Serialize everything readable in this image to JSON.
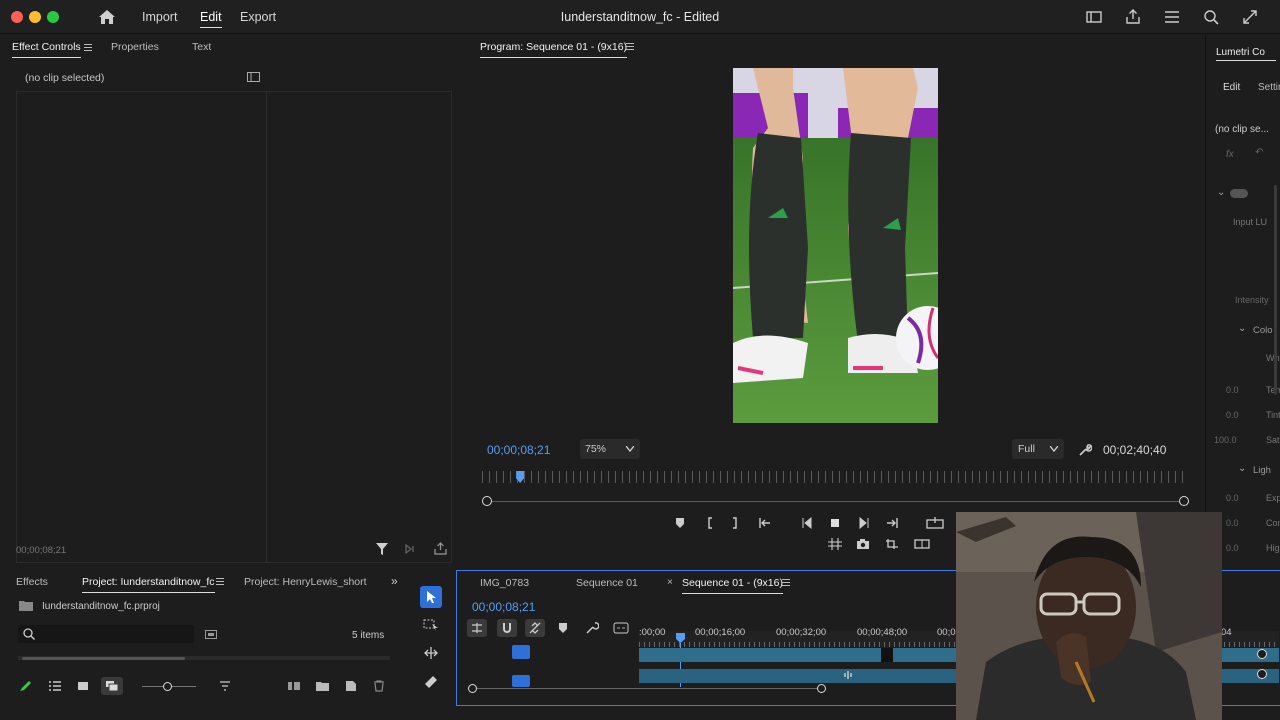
{
  "topbar": {
    "nav": [
      "Import",
      "Edit",
      "Export"
    ],
    "active_nav": "Edit",
    "title": "Iunderstanditnow_fc - Edited"
  },
  "effect_controls": {
    "tabs": [
      "Effect Controls",
      "Properties",
      "Text"
    ],
    "no_clip": "(no clip selected)",
    "timecode": "00;00;08;21"
  },
  "program": {
    "title": "Program: Sequence 01 - (9x16)",
    "timecode": "00;00;08;21",
    "zoom": "75%",
    "quality": "Full",
    "duration": "00;02;40;40",
    "playhead_fraction": 0.054
  },
  "lumetri": {
    "title": "Lumetri Co",
    "tabs": [
      "Edit",
      "Settin"
    ],
    "no_clip": "(no clip se...",
    "rows": [
      "Input LU",
      "Intensity",
      "Colo",
      "Whi",
      "Tem",
      "Tint",
      "Satu",
      "Ligh",
      "Exp",
      "Con",
      "High"
    ],
    "values": [
      "0.0",
      "0.0",
      "100.0",
      "0.0",
      "0.0",
      "0.0"
    ]
  },
  "project": {
    "tabs": [
      "Effects",
      "Project: Iunderstanditnow_fc",
      "Project: HenryLewis_short"
    ],
    "file": "Iunderstanditnow_fc.prproj",
    "items_count": "5 items",
    "search_placeholder": ""
  },
  "timeline": {
    "tabs": [
      "IMG_0783",
      "Sequence 01",
      "Sequence 01 - (9x16)"
    ],
    "timecode": "00;00;08;21",
    "ruler_labels": [
      ":00;00",
      "00;00;16;00",
      "00;00;32;00",
      "00;00;48;00",
      "00;0",
      "04"
    ]
  },
  "colors": {
    "accent": "#3f7be0",
    "timecode_blue": "#5a9cf2",
    "track_teal": "#2e6e8a",
    "pitch_green": "#3d7d2c"
  }
}
